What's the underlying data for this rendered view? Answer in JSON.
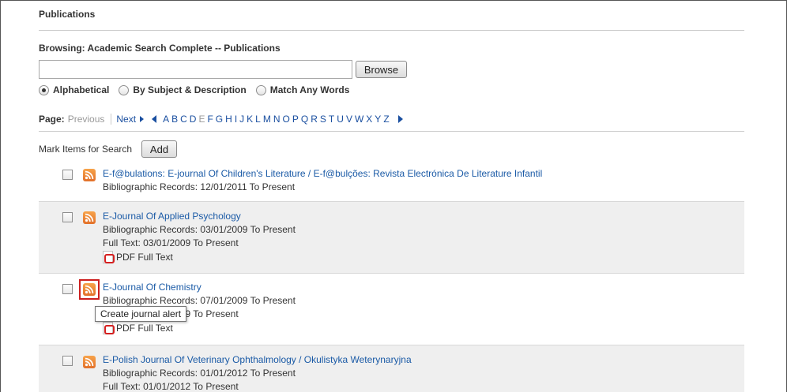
{
  "header": {
    "title": "Publications"
  },
  "browsing": {
    "label": "Browsing:  Academic Search Complete -- Publications"
  },
  "search": {
    "value": "",
    "browse_label": "Browse"
  },
  "radios": [
    {
      "label": "Alphabetical",
      "checked": true
    },
    {
      "label": "By Subject & Description",
      "checked": false
    },
    {
      "label": "Match Any Words",
      "checked": false
    }
  ],
  "pager": {
    "label": "Page:",
    "previous": "Previous",
    "next": "Next",
    "letters": [
      "A",
      "B",
      "C",
      "D",
      "E",
      "F",
      "G",
      "H",
      "I",
      "J",
      "K",
      "L",
      "M",
      "N",
      "O",
      "P",
      "Q",
      "R",
      "S",
      "T",
      "U",
      "V",
      "W",
      "X",
      "Y",
      "Z"
    ],
    "disabled_letter": "E"
  },
  "mark": {
    "label": "Mark Items for Search",
    "add_label": "Add"
  },
  "items": [
    {
      "title": "E-f@bulations: E-journal Of Children's Literature / E-f@bulções: Revista Electrónica De Literature Infantil",
      "biblio": "Bibliographic Records:  12/01/2011 To Present"
    },
    {
      "title": "E-Journal Of Applied Psychology",
      "biblio": "Bibliographic Records:  03/01/2009 To Present",
      "fulltext": "Full Text:  03/01/2009 To Present",
      "pdf": "PDF Full Text"
    },
    {
      "title": "E-Journal Of Chemistry",
      "biblio": "Bibliographic Records:  07/01/2009 To Present",
      "fulltext": "Full Text:  07/01/2009 To Present",
      "pdf": "PDF Full Text"
    },
    {
      "title": "E-Polish Journal Of Veterinary Ophthalmology / Okulistyka Weterynaryjna",
      "biblio": "Bibliographic Records:  01/01/2012 To Present",
      "fulltext": "Full Text:  01/01/2012 To Present"
    }
  ],
  "tooltip": {
    "text": "Create journal alert"
  },
  "colors": {
    "link": "#1a5aa6",
    "rss": "#e2702a",
    "highlight": "#cc1f1f",
    "shade": "#efefef"
  }
}
